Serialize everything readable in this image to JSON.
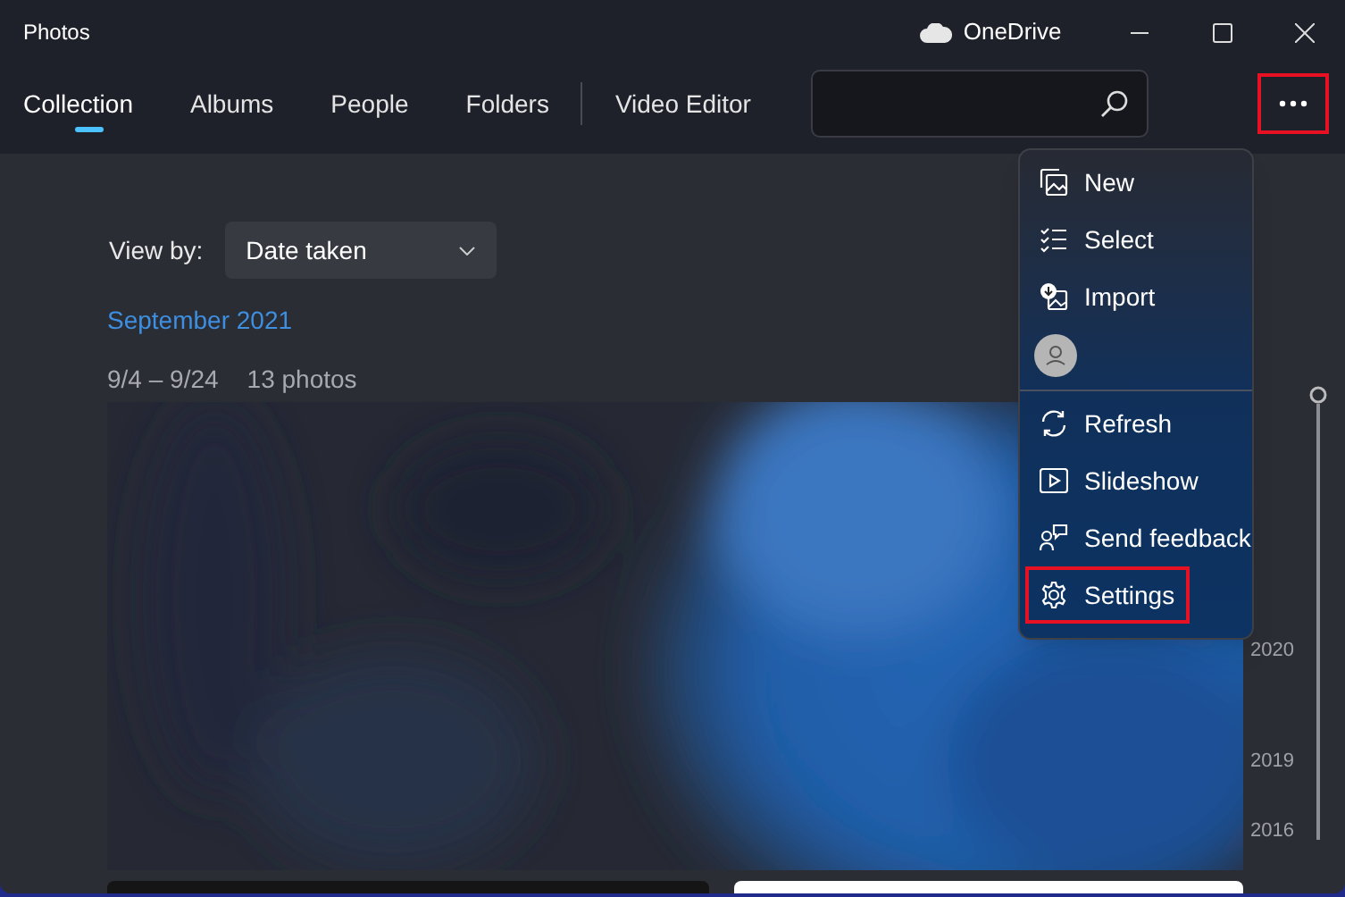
{
  "window": {
    "title": "Photos"
  },
  "cloud": {
    "label": "OneDrive"
  },
  "tabs": [
    {
      "label": "Collection",
      "selected": true
    },
    {
      "label": "Albums",
      "selected": false
    },
    {
      "label": "People",
      "selected": false
    },
    {
      "label": "Folders",
      "selected": false
    },
    {
      "label": "Video Editor",
      "selected": false
    }
  ],
  "more_button": {
    "highlighted": true
  },
  "view_by": {
    "label": "View by:",
    "value": "Date taken"
  },
  "group": {
    "title": "September 2021",
    "range": "9/4 – 9/24",
    "count": "13 photos"
  },
  "timeline": {
    "years": [
      "2020",
      "2019",
      "2016"
    ]
  },
  "menu": {
    "items": [
      {
        "kind": "new",
        "label": "New",
        "highlighted": false
      },
      {
        "kind": "select",
        "label": "Select",
        "highlighted": false
      },
      {
        "kind": "import",
        "label": "Import",
        "highlighted": false
      },
      {
        "kind": "account",
        "highlighted": false
      },
      {
        "kind": "refresh",
        "label": "Refresh",
        "highlighted": false
      },
      {
        "kind": "slideshow",
        "label": "Slideshow",
        "highlighted": false
      },
      {
        "kind": "feedback",
        "label": "Send feedback",
        "highlighted": false
      },
      {
        "kind": "settings",
        "label": "Settings",
        "highlighted": true
      }
    ]
  }
}
